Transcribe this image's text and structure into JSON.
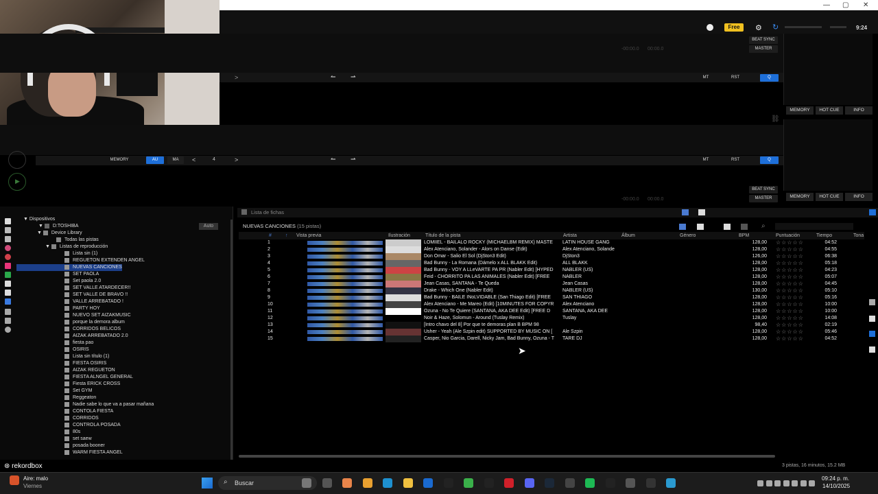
{
  "window": {
    "minimize": "—",
    "maximize": "▢",
    "close": "✕"
  },
  "topbar": {
    "free": "Free",
    "time": "9:24"
  },
  "deck1": {
    "beat_sync": "BEAT SYNC",
    "master": "MASTER",
    "time1": "-00:00.0",
    "time2": "00:00.0",
    "mt": "MT",
    "rst": "RST",
    "q": "Q"
  },
  "deck2": {
    "beat_sync": "BEAT SYNC",
    "master": "MASTER",
    "time1": "-00:00.0",
    "time2": "00:00.0",
    "mt": "MT",
    "rst": "RST",
    "q": "Q",
    "memory": "MEMORY",
    "au": "AU",
    "ma": "MA",
    "loop": "4"
  },
  "side_tabs": {
    "memory": "MEMORY",
    "hot_cue": "HOT CUE",
    "info": "INFO"
  },
  "tree": {
    "dispositivos": "Dispositivos",
    "device": "D:TOSHIBA",
    "auto": "Auto",
    "device_library": "Device Library",
    "todas": "Todas las pistas",
    "listas": "Listas de reproducción",
    "playlists": [
      "Lista sin  (1)",
      "REGUETON EXTENDEN ANGEL",
      "NUEVAS CANCIONES",
      "SET PAOLA",
      "Set paola 2.0",
      "SET VALLE ATARDECER!!",
      "SET VALLE DE BRAVO !!",
      "VALLE ARREBATADO !",
      "PARTY HOY",
      "NUEVO SET AIZAKMUSIC",
      "porque la demora album",
      "CORRIDOS BELICOS",
      "AIZAK ARREBATADO 2.0",
      "fiesta pao",
      "OSIRIS",
      "Lista sin título (1)",
      "FIESTA OSIRIS",
      "AIZAK REGUETON",
      "FIESTA ALNGEL GENERAL",
      "Fiesta ERICK CROSS",
      "Set GYM",
      "Reggeaton",
      "Nadie sabe lo que va a pasar mañana",
      "CONTOLA FIESTA",
      "CORRIDOS",
      "CONTROLA POSADA",
      "80s",
      "set saew",
      "posada booner",
      "WARM FIESTA ANGEL"
    ]
  },
  "browser": {
    "lista_fichas": "Lista de fichas",
    "playlist_name": "NUEVAS CANCIONES",
    "playlist_count": "(15 pistas)"
  },
  "columns": {
    "num": "#",
    "preview": "Vista previa",
    "art": "Ilustración",
    "title": "Título de la pista",
    "artist": "Artista",
    "album": "Álbum",
    "genre": "Género",
    "bpm": "BPM",
    "rating": "Puntuación",
    "time": "Tiempo",
    "key": "Tona"
  },
  "tracks": [
    {
      "n": "1",
      "title": "LOMIIEL - BAILALO ROCKY (MICHAELBM REMIX) MASTE",
      "artist": "LATIN HOUSE GANG",
      "bpm": "128,00",
      "time": "04:52"
    },
    {
      "n": "2",
      "title": "Alex Atenciano, Solander - Alors on Danse (Edit)",
      "artist": "Alex Atenciano, Solande",
      "bpm": "128,00",
      "time": "04:55"
    },
    {
      "n": "3",
      "title": "Don Omar - Salio El Sol (DjSton3 Edit)",
      "artist": "DjSton3",
      "bpm": "126,00",
      "time": "06:38"
    },
    {
      "n": "4",
      "title": "Bad Bunny - La Romana (Dámelo x ALL BLAKK Edit)",
      "artist": "ALL BLAKK",
      "bpm": "128,00",
      "time": "05:18"
    },
    {
      "n": "5",
      "title": "Bad Bunny - VOY A LLeVARTE PA PR (Nabler Edit) [HYPED",
      "artist": "NABLER (US)",
      "bpm": "128,00",
      "time": "04:23"
    },
    {
      "n": "6",
      "title": "Feid - CHORRITO PA LAS ANIMALES (Nabler Edit) [FREE",
      "artist": "NABLER",
      "bpm": "128,00",
      "time": "05:07"
    },
    {
      "n": "7",
      "title": "Jean Casas, SANTANA - Te Queda",
      "artist": "Jean Casas",
      "bpm": "128,00",
      "time": "04:45"
    },
    {
      "n": "8",
      "title": "Drake - Which One (Nabler Edit)",
      "artist": "NABLER (US)",
      "bpm": "130,00",
      "time": "05:10"
    },
    {
      "n": "9",
      "title": "Bad Bunny - BAILE INoLVIDABLE (San Thiago Edit) [FREE",
      "artist": "SAN THIAGO",
      "bpm": "128,00",
      "time": "05:16"
    },
    {
      "n": "10",
      "title": "Alex Atenciano - Me Mareo (Edit) [10MINUTES FOR COPYR",
      "artist": "Alex Atenciano",
      "bpm": "128,00",
      "time": "10:00"
    },
    {
      "n": "11",
      "title": "Ozuna - No Te Quiere (SANTANA, AKA DEE Edit) [FREE D",
      "artist": "SANTANA, AKA DEE",
      "bpm": "128,00",
      "time": "10:00"
    },
    {
      "n": "12",
      "title": "Noir & Haze, Solomun - Around (Tuslay Remix)",
      "artist": "Tuslay",
      "bpm": "128,00",
      "time": "14:08"
    },
    {
      "n": "13",
      "title": "[Intro chavo del 8]    Por que te demoras  plan B   BPM 98",
      "artist": "",
      "bpm": "98,40",
      "time": "02:19"
    },
    {
      "n": "14",
      "title": "Usher - Yeah (Ale Szpin edit) SUPPORTED BY MUSIC ON [",
      "artist": "Ale Szpin",
      "bpm": "128,00",
      "time": "05:46"
    },
    {
      "n": "15",
      "title": "Casper, Nio Garcia, Darell, Nicky Jam, Bad Bunny, Ozuna - T",
      "artist": "TARE DJ",
      "bpm": "128,00",
      "time": "04:52"
    }
  ],
  "status": "3 pistas, 16 minutos, 15.2 MB",
  "logo": "rekordbox",
  "taskbar": {
    "weather": "Aire: malo",
    "weather_sub": "Viernes",
    "search": "Buscar",
    "time": "09:24 p. m.",
    "date": "14/10/2025"
  }
}
